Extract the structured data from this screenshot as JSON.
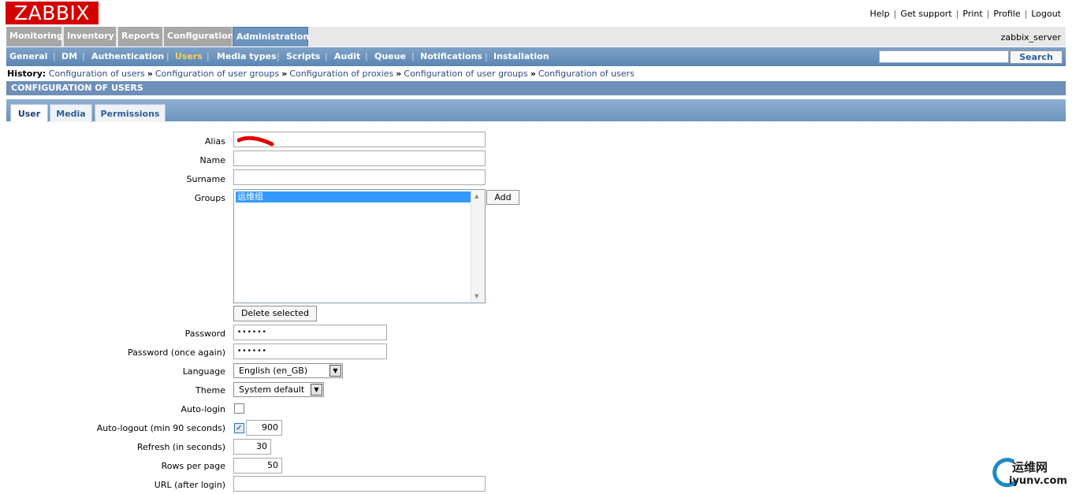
{
  "header": {
    "logo": "ZABBIX",
    "links": [
      "Help",
      "Get support",
      "Print",
      "Profile",
      "Logout"
    ],
    "server": "zabbix_server"
  },
  "main_menu": [
    "Monitoring",
    "Inventory",
    "Reports",
    "Configuration",
    "Administration"
  ],
  "sub_menu": [
    "General",
    "DM",
    "Authentication",
    "Users",
    "Media types",
    "Scripts",
    "Audit",
    "Queue",
    "Notifications",
    "Installation"
  ],
  "search": {
    "button": "Search",
    "value": ""
  },
  "history": {
    "label": "History:",
    "items": [
      "Configuration of users",
      "Configuration of user groups",
      "Configuration of proxies",
      "Configuration of user groups",
      "Configuration of users"
    ],
    "separator": "»"
  },
  "section_title": "CONFIGURATION OF USERS",
  "tabs": [
    "User",
    "Media",
    "Permissions"
  ],
  "form": {
    "alias_label": "Alias",
    "name_label": "Name",
    "surname_label": "Surname",
    "groups_label": "Groups",
    "groups": [
      "运维组"
    ],
    "add_button": "Add",
    "delete_button": "Delete selected",
    "password_label": "Password",
    "password_value": "••••••",
    "password_again_label": "Password (once again)",
    "password_again_value": "••••••",
    "language_label": "Language",
    "language_value": "English (en_GB)",
    "theme_label": "Theme",
    "theme_value": "System default",
    "autologin_label": "Auto-login",
    "autologout_label": "Auto-logout (min 90 seconds)",
    "autologout_value": "900",
    "refresh_label": "Refresh (in seconds)",
    "refresh_value": "30",
    "rows_label": "Rows per page",
    "rows_value": "50",
    "url_label": "URL (after login)"
  },
  "watermark": {
    "top": "运维网",
    "bottom": "iyunv.com"
  },
  "colors": {
    "logo": "#d40000",
    "menu_active": "#6d94bf",
    "submenu_selected": "#f3d35c",
    "section": "#6d8fb8"
  }
}
